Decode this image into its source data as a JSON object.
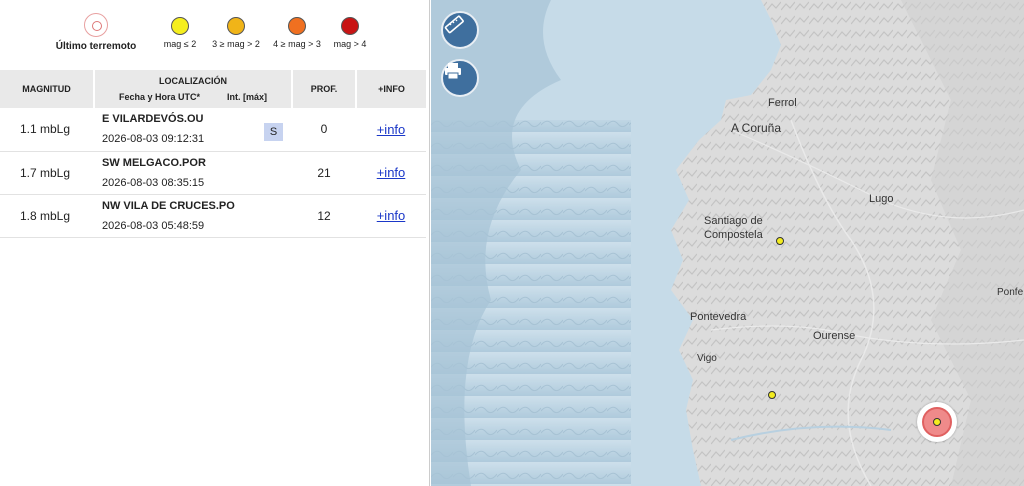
{
  "legend": {
    "last_label": "Último terremoto",
    "items": [
      {
        "label": "mag ≤ 2",
        "color": "#f5ee1e"
      },
      {
        "label": "3 ≥ mag > 2",
        "color": "#f0b418"
      },
      {
        "label": "4 ≥ mag > 3",
        "color": "#f07020"
      },
      {
        "label": "mag > 4",
        "color": "#c81414"
      }
    ]
  },
  "table": {
    "headers": {
      "magnitud": "MAGNITUD",
      "localizacion": "LOCALIZACIÓN",
      "fecha": "Fecha y Hora UTC*",
      "int": "Int. [máx]",
      "prof": "PROF.",
      "info": "+INFO"
    },
    "rows": [
      {
        "mag": "1.1 mbLg",
        "place": "E VILARDEVÓS.OU",
        "date": "2026-08-03 09:12:31",
        "intensity": "S",
        "depth": "0",
        "info": "+info"
      },
      {
        "mag": "1.7 mbLg",
        "place": "SW MELGACO.POR",
        "date": "2026-08-03 08:35:15",
        "intensity": "",
        "depth": "21",
        "info": "+info"
      },
      {
        "mag": "1.8 mbLg",
        "place": "NW VILA DE CRUCES.PO",
        "date": "2026-08-03 05:48:59",
        "intensity": "",
        "depth": "12",
        "info": "+info"
      }
    ]
  },
  "map": {
    "buttons": [
      "ruler-icon",
      "printer-icon"
    ],
    "labels": {
      "ferrol": "Ferrol",
      "coruna": "A Coruña",
      "lugo": "Lugo",
      "santiago1": "Santiago de",
      "santiago2": "Compostela",
      "pontevedra": "Pontevedra",
      "ourense": "Ourense",
      "vigo": "Vigo",
      "ponfe": "Ponfe"
    }
  }
}
